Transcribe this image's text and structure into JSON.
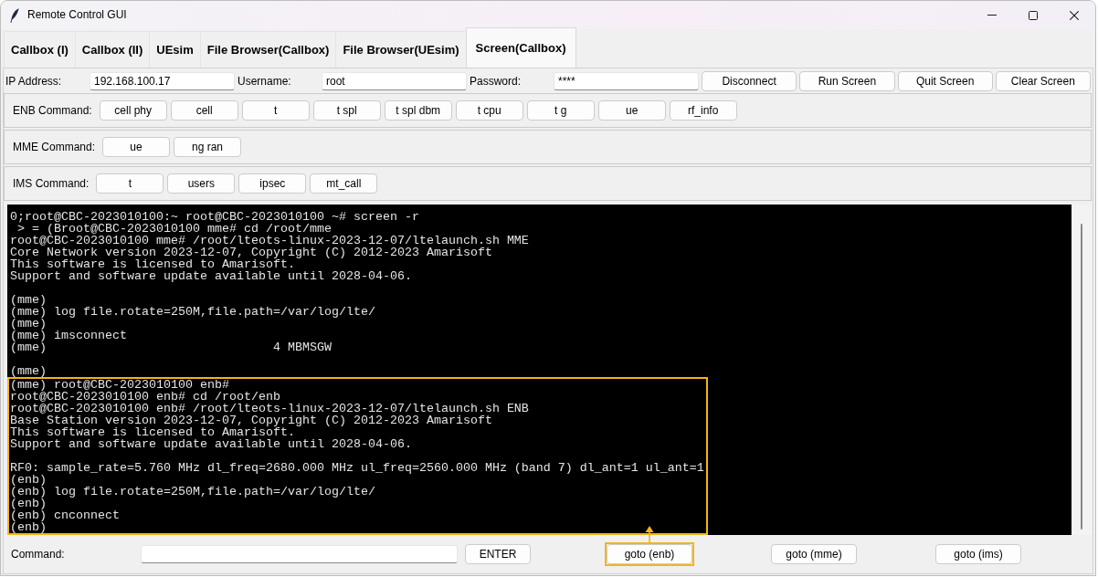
{
  "window": {
    "title": "Remote Control GUI"
  },
  "tabs": [
    {
      "label": "Callbox (I)",
      "selected": false
    },
    {
      "label": "Callbox (II)",
      "selected": false
    },
    {
      "label": "UEsim",
      "selected": false
    },
    {
      "label": "File Browser(Callbox)",
      "selected": false
    },
    {
      "label": "File Browser(UEsim)",
      "selected": false
    },
    {
      "label": "Screen(Callbox)",
      "selected": true
    }
  ],
  "connection": {
    "fields": [
      {
        "label": "IP Address:",
        "value": "192.168.100.17"
      },
      {
        "label": "Username:",
        "value": "root"
      },
      {
        "label": "Password:",
        "value": "****"
      }
    ],
    "buttons": [
      "Disconnect",
      "Run Screen",
      "Quit Screen",
      "Clear Screen"
    ]
  },
  "command_groups": [
    {
      "label": "ENB Command:",
      "buttons": [
        "cell phy",
        "cell",
        "t",
        "t spl",
        "t spl dbm",
        "t cpu",
        "t g",
        "ue",
        "rf_info"
      ]
    },
    {
      "label": "MME Command:",
      "buttons": [
        "ue",
        "ng ran"
      ]
    },
    {
      "label": "IMS Command:",
      "buttons": [
        "t",
        "users",
        "ipsec",
        "mt_call"
      ]
    }
  ],
  "terminal": {
    "sections": [
      {
        "highlighted": false,
        "paragraphs": [
          [
            "0;root@CBC-2023010100:~ root@CBC-2023010100 ~# screen -r",
            " > = (Broot@CBC-2023010100 mme# cd /root/mme",
            "root@CBC-2023010100 mme# /root/lteots-linux-2023-12-07/ltelaunch.sh MME",
            "Core Network version 2023-12-07, Copyright (C) 2012-2023 Amarisoft",
            "This software is licensed to Amarisoft.",
            "Support and software update available until 2028-04-06."
          ],
          [
            "(mme)",
            "(mme) log file.rotate=250M,file.path=/var/log/lte/",
            "(mme)",
            "(mme) imsconnect",
            "(mme)                               4 MBMSGW"
          ],
          [
            "(mme)"
          ]
        ]
      },
      {
        "highlighted": true,
        "paragraphs": [
          [
            "(mme) root@CBC-2023010100 enb#",
            "root@CBC-2023010100 enb# cd /root/enb",
            "root@CBC-2023010100 enb# /root/lteots-linux-2023-12-07/ltelaunch.sh ENB",
            "Base Station version 2023-12-07, Copyright (C) 2012-2023 Amarisoft",
            "This software is licensed to Amarisoft.",
            "Support and software update available until 2028-04-06."
          ],
          [
            "RF0: sample_rate=5.760 MHz dl_freq=2680.000 MHz ul_freq=2560.000 MHz (band 7) dl_ant=1 ul_ant=1",
            "(enb)",
            "(enb) log file.rotate=250M,file.path=/var/log/lte/",
            "(enb)",
            "(enb) cnconnect",
            "(enb)"
          ]
        ]
      }
    ]
  },
  "command_bar": {
    "label": "Command:",
    "enter_button": "ENTER",
    "goto_buttons": [
      {
        "label": "goto (enb)",
        "highlighted": true
      },
      {
        "label": "goto (mme)",
        "highlighted": false
      },
      {
        "label": "goto (ims)",
        "highlighted": false
      }
    ]
  }
}
